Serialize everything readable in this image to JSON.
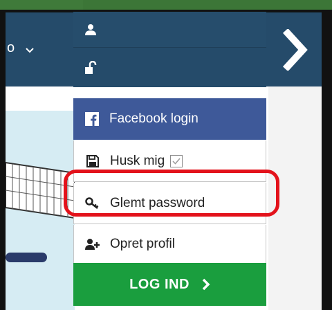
{
  "header": {
    "language_label": "o",
    "next_icon": "chevron-right-icon"
  },
  "menu": {
    "user_icon": "user-icon",
    "lock_icon": "unlock-icon",
    "facebook": {
      "icon": "facebook-icon",
      "label": "Facebook login"
    },
    "remember": {
      "icon": "save-icon",
      "label": "Husk mig",
      "checked": false
    },
    "forgot": {
      "icon": "key-icon",
      "label": "Glemt password"
    },
    "create": {
      "icon": "user-plus-icon",
      "label": "Opret profil"
    },
    "login": {
      "label": "LOG IND",
      "icon": "chevron-right-icon"
    }
  },
  "colors": {
    "header": "#254b6a",
    "facebook": "#3e5999",
    "login": "#1a9e3e",
    "highlight": "#e3121b"
  }
}
